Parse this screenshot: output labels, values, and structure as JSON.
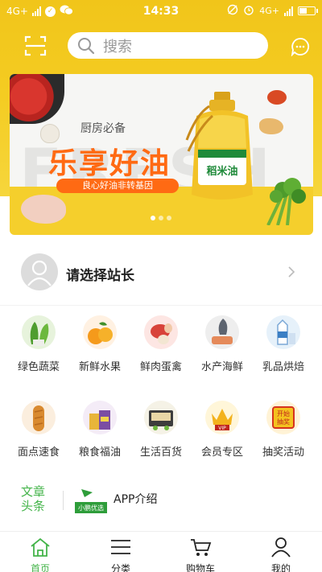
{
  "status_bar": {
    "network_left": "4G+",
    "time": "14:33",
    "network_right": "4G+"
  },
  "search": {
    "placeholder": "搜索"
  },
  "banner": {
    "watermark": "FRESH",
    "subtitle": "厨房必备",
    "headline": "乐享好油",
    "tagline": "良心好油非转基因",
    "bottle_brand": "稻米油",
    "slide_count": 3,
    "active_slide": 1
  },
  "station": {
    "label": "请选择站长"
  },
  "categories": [
    {
      "label": "绿色蔬菜",
      "icon": "vegetables-icon"
    },
    {
      "label": "新鲜水果",
      "icon": "fruit-icon"
    },
    {
      "label": "鲜肉蛋禽",
      "icon": "meat-egg-icon"
    },
    {
      "label": "水产海鲜",
      "icon": "seafood-icon"
    },
    {
      "label": "乳品烘焙",
      "icon": "dairy-icon"
    },
    {
      "label": "面点速食",
      "icon": "bread-icon"
    },
    {
      "label": "粮食福油",
      "icon": "grain-oil-icon"
    },
    {
      "label": "生活百货",
      "icon": "daily-goods-icon"
    },
    {
      "label": "会员专区",
      "icon": "vip-icon"
    },
    {
      "label": "抽奖活动",
      "icon": "lottery-icon"
    }
  ],
  "lottery_badge": [
    "开始",
    "抽奖"
  ],
  "news": {
    "tag_line1": "文章",
    "tag_line2": "头条",
    "item_title": "APP介绍",
    "thumb_text": "小鹏优选"
  },
  "tabs": [
    {
      "label": "首页",
      "icon": "home-icon",
      "active": true
    },
    {
      "label": "分类",
      "icon": "list-icon",
      "active": false
    },
    {
      "label": "购物车",
      "icon": "cart-icon",
      "active": false
    },
    {
      "label": "我的",
      "icon": "user-icon",
      "active": false
    }
  ],
  "colors": {
    "brand_yellow": "#f4cc22",
    "accent_green": "#44b44a",
    "banner_orange": "#ff6a13"
  }
}
